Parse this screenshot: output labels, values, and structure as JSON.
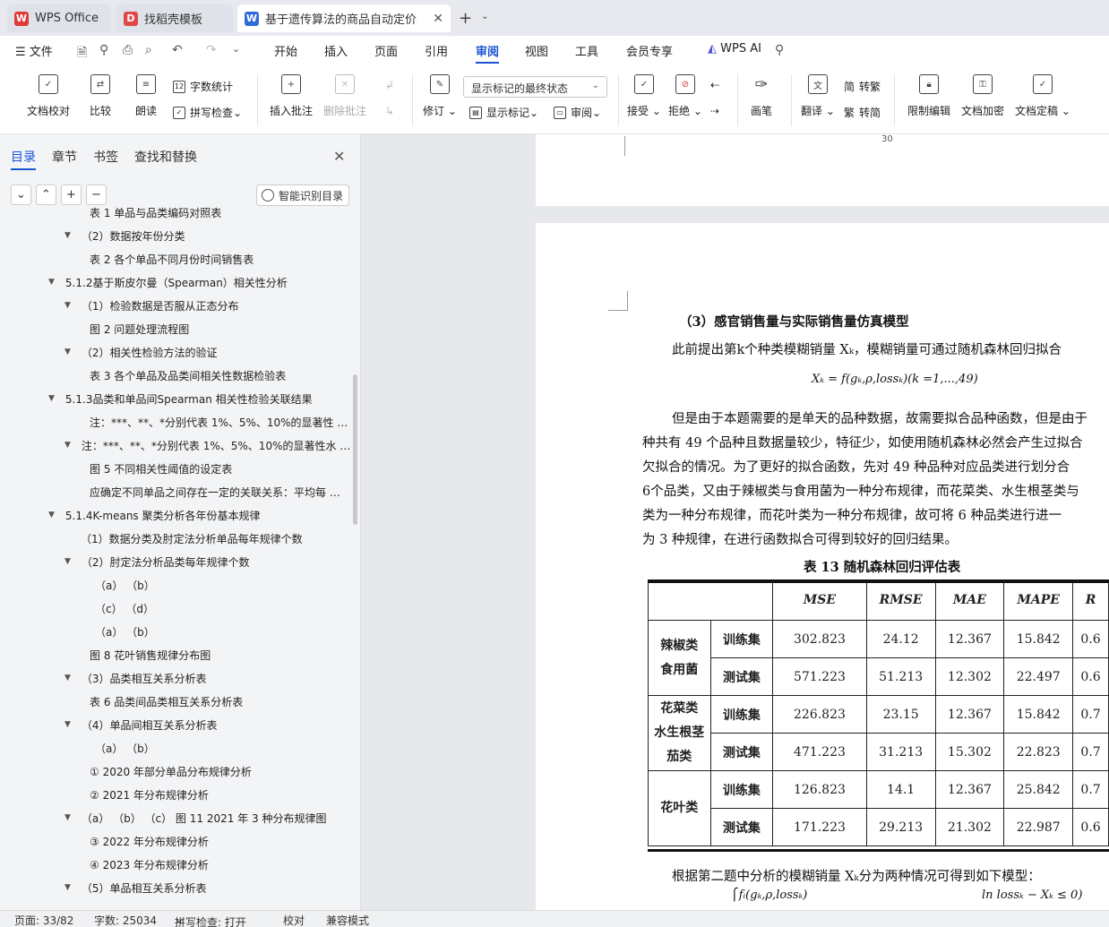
{
  "tabs": [
    {
      "label": "WPS Office",
      "icon": "wps-logo-icon",
      "color": "#e03a3a"
    },
    {
      "label": "找稻壳模板",
      "icon": "docer-icon",
      "color": "#e04848"
    },
    {
      "label": "基于遗传算法的商品自动定价与",
      "icon": "word-doc-icon",
      "color": "#2f6bdb"
    }
  ],
  "menu": {
    "file": "文件",
    "items": [
      "开始",
      "插入",
      "页面",
      "引用",
      "审阅",
      "视图",
      "工具",
      "会员专享"
    ],
    "active": "审阅",
    "ai": "WPS AI"
  },
  "ribbon": {
    "check": "文档校对",
    "compare": "比较",
    "read": "朗读",
    "wordcount": "字数统计",
    "spell": "拼写检查",
    "insert_comment": "插入批注",
    "delete_comment": "删除批注",
    "track": "修订",
    "markup_state": "显示标记的最终状态",
    "show_markup": "显示标记",
    "review": "审阅",
    "accept": "接受",
    "reject": "拒绝",
    "pen": "画笔",
    "translate": "翻译",
    "to_trad": "繁转简",
    "trad_label_a": "简",
    "trad_label_b": "转繁",
    "simp_label": "转简",
    "restrict": "限制编辑",
    "encrypt": "文档加密",
    "finalize": "文档定稿"
  },
  "nav": {
    "tabs": [
      "目录",
      "章节",
      "书签",
      "查找和替换"
    ],
    "active_tab": "目录",
    "smart_toc": "智能识别目录",
    "items": [
      {
        "text": "表 1 单品与品类编码对照表",
        "indent": 100,
        "arrow": false
      },
      {
        "text": "（2）数据按年份分类",
        "indent": 76,
        "arrow": true
      },
      {
        "text": "表 2 各个单品不同月份时间销售表",
        "indent": 100,
        "arrow": false
      },
      {
        "text": "5.1.2基于斯皮尔曼（Spearman）相关性分析",
        "indent": 58,
        "arrow": true
      },
      {
        "text": "（1）检验数据是否服从正态分布",
        "indent": 76,
        "arrow": true
      },
      {
        "text": "图 2 问题处理流程图",
        "indent": 100,
        "arrow": false
      },
      {
        "text": "（2）相关性检验方法的验证",
        "indent": 76,
        "arrow": true
      },
      {
        "text": "表 3 各个单品及品类间相关性数据检验表",
        "indent": 100,
        "arrow": false
      },
      {
        "text": "5.1.3品类和单品间Spearman 相关性检验关联结果",
        "indent": 58,
        "arrow": true
      },
      {
        "text": "注：***、**、*分别代表 1%、5%、10%的显著性 …",
        "indent": 100,
        "arrow": false
      },
      {
        "text": "注：***、**、*分别代表 1%、5%、10%的显著性水 …",
        "indent": 76,
        "arrow": true
      },
      {
        "text": "图 5 不同相关性阈值的设定表",
        "indent": 100,
        "arrow": false
      },
      {
        "text": "应确定不同单品之间存在一定的关联关系：平均每 …",
        "indent": 100,
        "arrow": false
      },
      {
        "text": "5.1.4K-means 聚类分析各年份基本规律",
        "indent": 58,
        "arrow": true
      },
      {
        "text": "（1）数据分类及肘定法分析单品每年规律个数",
        "indent": 90,
        "arrow": false
      },
      {
        "text": "（2）肘定法分析品类每年规律个数",
        "indent": 76,
        "arrow": true
      },
      {
        "text": "（a）  （b）",
        "indent": 106,
        "arrow": false
      },
      {
        "text": "（c）  （d）",
        "indent": 106,
        "arrow": false
      },
      {
        "text": "（a）  （b）",
        "indent": 106,
        "arrow": false
      },
      {
        "text": "图 8 花叶销售规律分布图",
        "indent": 100,
        "arrow": false
      },
      {
        "text": "（3）品类相互关系分析表",
        "indent": 76,
        "arrow": true
      },
      {
        "text": "表 6 品类间品类相互关系分析表",
        "indent": 100,
        "arrow": false
      },
      {
        "text": "（4）单品间相互关系分析表",
        "indent": 76,
        "arrow": true
      },
      {
        "text": "（a）  （b）",
        "indent": 106,
        "arrow": false
      },
      {
        "text": "① 2020 年部分单品分布规律分析",
        "indent": 100,
        "arrow": false
      },
      {
        "text": "② 2021 年分布规律分析",
        "indent": 100,
        "arrow": false
      },
      {
        "text": "（a）    （b）  （c） 图 11 2021 年 3 种分布规律图",
        "indent": 76,
        "arrow": true
      },
      {
        "text": "③ 2022 年分布规律分析",
        "indent": 100,
        "arrow": false
      },
      {
        "text": "④ 2023 年分布规律分析",
        "indent": 100,
        "arrow": false
      },
      {
        "text": "（5）单品相互关系分析表",
        "indent": 76,
        "arrow": true
      }
    ]
  },
  "doc": {
    "page_number": "30",
    "heading": "（3）感官销售量与实际销售量仿真模型",
    "p1": "此前提出第k个种类模糊销量 Xₖ，模糊销量可通过随机森林回归拟合",
    "formula1": "Xₖ = f(gₖ,ρ,lossₖ)(k =1,...,49)",
    "p2_lines": [
      "但是由于本题需要的是单天的品种数据，故需要拟合品种函数，但是由于",
      "种共有 49 个品种且数据量较少，特征少，如使用随机森林必然会产生过拟合",
      "欠拟合的情况。为了更好的拟合函数，先对 49 种品种对应品类进行划分合",
      "6个品类，又由于辣椒类与食用菌为一种分布规律，而花菜类、水生根茎类与",
      "类为一种分布规律，而花叶类为一种分布规律，故可将 6 种品类进行进一",
      "为 3 种规律，在进行函数拟合可得到较好的回归结果。"
    ],
    "table_title": "表 13   随机森林回归评估表",
    "table": {
      "headers": [
        "MSE",
        "RMSE",
        "MAE",
        "MAPE",
        "R"
      ],
      "groups": [
        {
          "category": [
            "辣椒类",
            "食用菌"
          ],
          "rows": [
            {
              "label": "训练集",
              "values": [
                "302.823",
                "24.12",
                "12.367",
                "15.842",
                "0.6"
              ]
            },
            {
              "label": "测试集",
              "values": [
                "571.223",
                "51.213",
                "12.302",
                "22.497",
                "0.6"
              ]
            }
          ]
        },
        {
          "category": [
            "花菜类",
            "水生根茎",
            "茄类"
          ],
          "rows": [
            {
              "label": "训练集",
              "values": [
                "226.823",
                "23.15",
                "12.367",
                "15.842",
                "0.7"
              ]
            },
            {
              "label": "测试集",
              "values": [
                "471.223",
                "31.213",
                "15.302",
                "22.823",
                "0.7"
              ]
            }
          ]
        },
        {
          "category": [
            "花叶类"
          ],
          "rows": [
            {
              "label": "训练集",
              "values": [
                "126.823",
                "14.1",
                "12.367",
                "25.842",
                "0.7"
              ]
            },
            {
              "label": "测试集",
              "values": [
                "171.223",
                "29.213",
                "21.302",
                "22.987",
                "0.6"
              ]
            }
          ]
        }
      ]
    },
    "p3": "根据第二题中分析的模糊销量 Xₖ分为两种情况可得到如下模型：",
    "formula2a": "⎧fᵢ(gₖ,ρ,lossₖ)",
    "formula2b": "ln lossₖ − Xₖ ≤ 0)"
  },
  "status": {
    "page": "页面: 33/82",
    "words": "字数: 25034",
    "spell": "拼写检查: 打开",
    "proof": "校对",
    "compat": "兼容模式"
  }
}
